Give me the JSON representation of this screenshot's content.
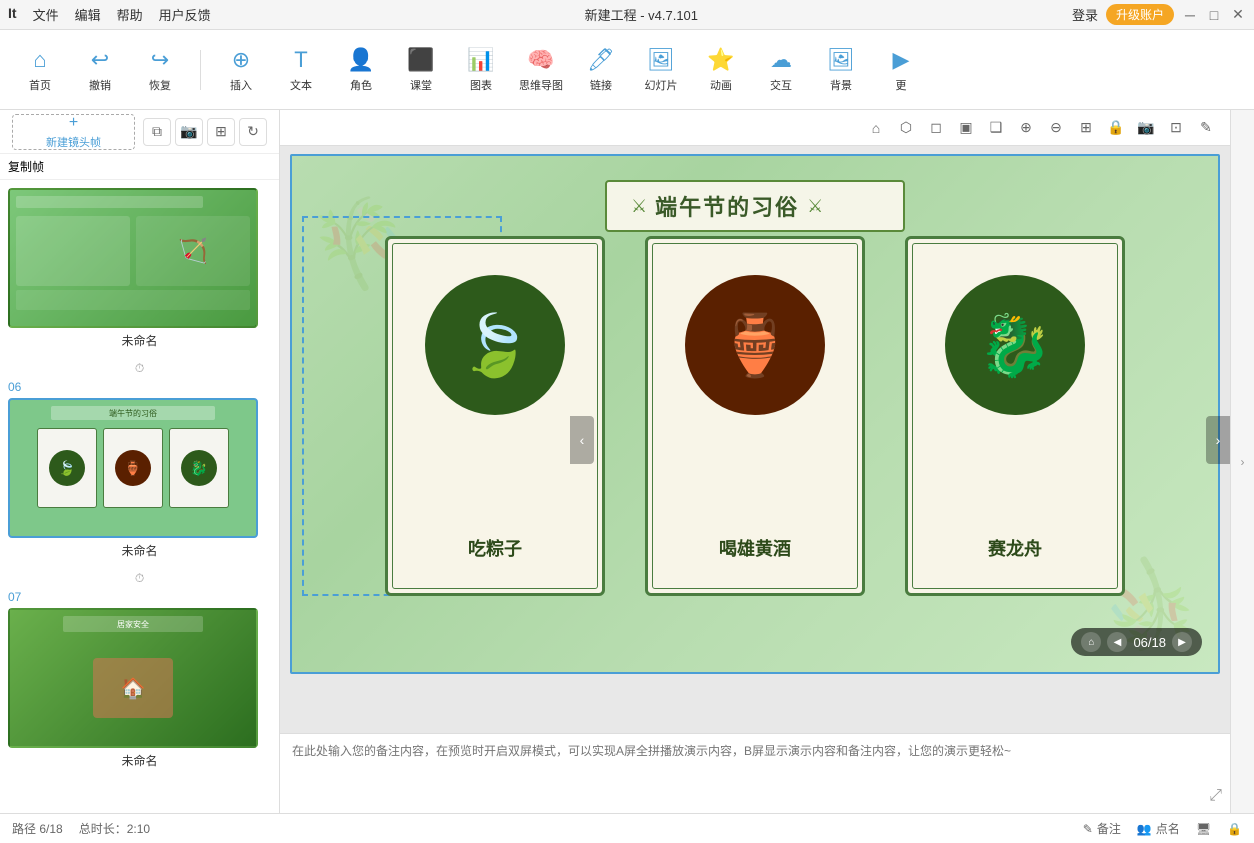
{
  "app": {
    "title": "新建工程 - v4.7.101",
    "logo": "It"
  },
  "menu": {
    "items": [
      "文件",
      "编辑",
      "帮助",
      "用户反馈"
    ]
  },
  "auth": {
    "login_label": "登录",
    "upgrade_label": "升级账户"
  },
  "window_controls": {
    "minimize": "─",
    "maximize": "□",
    "close": "✕"
  },
  "toolbar": {
    "home_label": "首页",
    "undo_label": "撤销",
    "redo_label": "恢复",
    "insert_label": "插入",
    "text_label": "文本",
    "character_label": "角色",
    "classroom_label": "课堂",
    "chart_label": "图表",
    "mindmap_label": "思维导图",
    "link_label": "链接",
    "slide_label": "幻灯片",
    "animation_label": "动画",
    "interactive_label": "交互",
    "background_label": "背景",
    "more_label": "更"
  },
  "left_panel": {
    "new_frame_label": "新建镜头帧",
    "copy_frame_label": "复制帧",
    "slides": [
      {
        "number": "",
        "label": "未命名",
        "thumb_type": "green_gradient"
      },
      {
        "number": "06",
        "label": "未命名",
        "thumb_type": "duanwu",
        "active": true
      },
      {
        "number": "07",
        "label": "未命名",
        "thumb_type": "home_safety"
      }
    ]
  },
  "canvas": {
    "slide_title": "端午节的习俗",
    "cards": [
      {
        "id": "card1",
        "label": "吃粽子",
        "icon": "🍃",
        "icon_type": "zongzi"
      },
      {
        "id": "card2",
        "label": "喝雄黄酒",
        "icon": "🏺",
        "icon_type": "wine"
      },
      {
        "id": "card3",
        "label": "赛龙舟",
        "icon": "🐉",
        "icon_type": "boat"
      }
    ],
    "slide_counter": "06/18",
    "deco_left": "🎋",
    "deco_right": "🎋"
  },
  "notes": {
    "placeholder": "在此处输入您的备注内容，在预览时开启双屏模式，可以实现A屏全拼播放演示内容，B屏显示演示内容和备注内容，让您的演示更轻松~"
  },
  "status": {
    "path_label": "路径 6/18",
    "duration_label": "总时长：2:10",
    "notes_btn": "备注",
    "points_btn": "点名",
    "screen_btn": "",
    "lock_btn": ""
  }
}
